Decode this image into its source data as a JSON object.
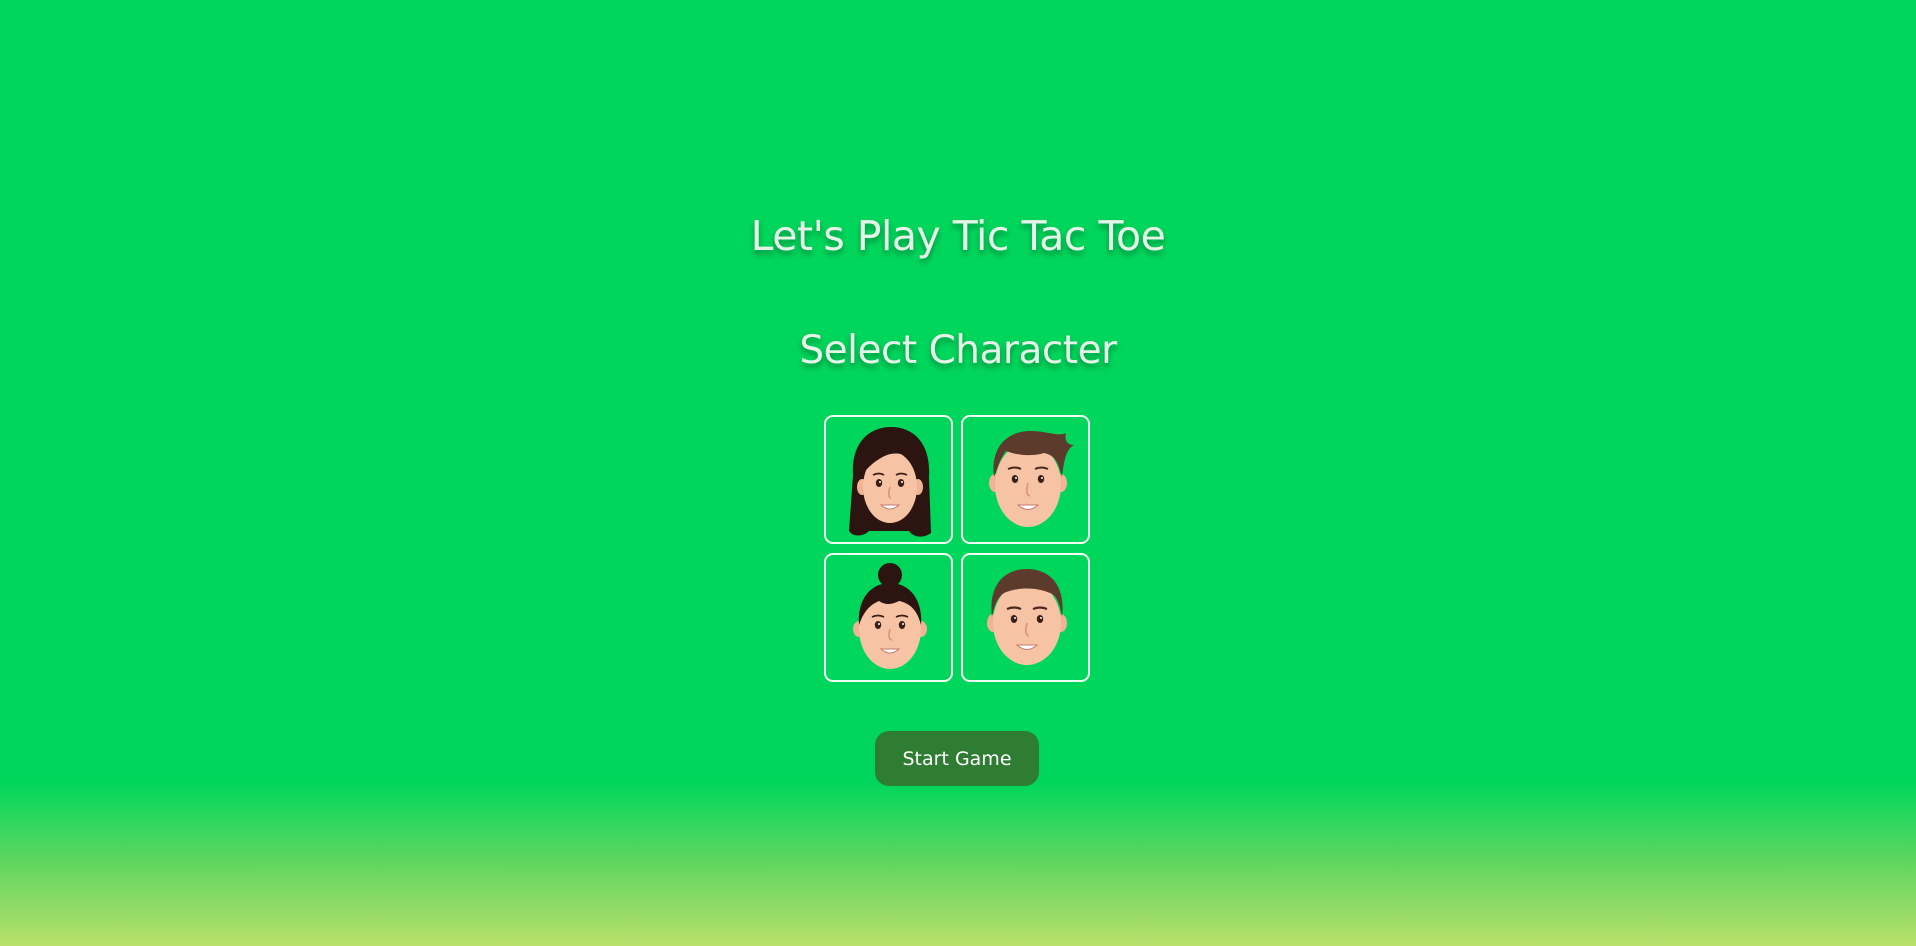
{
  "header": {
    "title": "Let's Play Tic Tac Toe",
    "subtitle": "Select Character"
  },
  "characters": [
    {
      "icon": "woman-long-hair-avatar-icon"
    },
    {
      "icon": "man-swept-hair-avatar-icon"
    },
    {
      "icon": "woman-hair-bun-avatar-icon"
    },
    {
      "icon": "man-short-hair-avatar-icon"
    }
  ],
  "actions": {
    "start_label": "Start Game"
  },
  "colors": {
    "background": "#00d65b",
    "background_bottom": "#b9e06b",
    "button": "#2e7d32",
    "text": "#e6f3e8",
    "card_border": "#f3fff4",
    "skin": "#f6c4a5",
    "dark_hair": "#2c1510",
    "brown_hair": "#5d3b2c"
  }
}
